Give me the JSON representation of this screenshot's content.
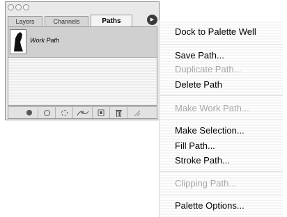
{
  "palette": {
    "tabs": [
      {
        "label": "Layers",
        "active": false
      },
      {
        "label": "Channels",
        "active": false
      },
      {
        "label": "Paths",
        "active": true
      }
    ],
    "menu_button_icon": "triangle-right-icon",
    "paths": [
      {
        "name": "Work Path",
        "selected": true
      }
    ],
    "bottom_buttons": [
      {
        "icon": "fill-path-icon"
      },
      {
        "icon": "stroke-path-icon"
      },
      {
        "icon": "load-selection-icon"
      },
      {
        "icon": "make-work-path-icon"
      },
      {
        "icon": "new-path-icon"
      },
      {
        "icon": "trash-icon"
      }
    ]
  },
  "menu": {
    "items": [
      {
        "label": "Dock to Palette Well",
        "enabled": true
      },
      {
        "label": "Save Path...",
        "enabled": true
      },
      {
        "label": "Duplicate Path...",
        "enabled": false
      },
      {
        "label": "Delete Path",
        "enabled": true
      },
      {
        "label": "Make Work Path...",
        "enabled": false
      },
      {
        "label": "Make Selection...",
        "enabled": true
      },
      {
        "label": "Fill Path...",
        "enabled": true
      },
      {
        "label": "Stroke Path...",
        "enabled": true
      },
      {
        "label": "Clipping Path...",
        "enabled": false
      },
      {
        "label": "Palette Options...",
        "enabled": true
      }
    ]
  }
}
